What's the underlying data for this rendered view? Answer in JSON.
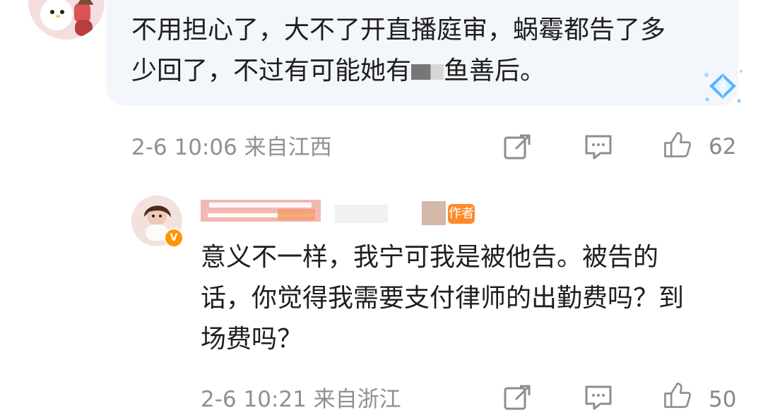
{
  "comment_1": {
    "text_line_1": "不用担心了，大不了开直播庭审，蜗霉都告了多",
    "text_line_2_before": "少回了，不过有可能她有",
    "text_line_2_after": "鱼善后。",
    "meta": "2-6 10:06 来自江西",
    "likes": "62"
  },
  "comment_2": {
    "author_tag": "作者",
    "text_line_1": "意义不一样，我宁可我是被他告。被告的",
    "text_line_2": "话，你觉得我需要支付律师的出勤费吗？到",
    "text_line_3": "场费吗？",
    "meta": "2-6 10:21 来自浙江",
    "likes": "50"
  },
  "icons": {
    "share": "share-icon",
    "comment": "comment-icon",
    "like": "like-icon",
    "verified": "verified-icon",
    "sticker": "diamond-sticker-icon"
  },
  "colors": {
    "bubble": "#f3f6fb",
    "meta_text": "#909090",
    "body_text": "#1e1e1e",
    "accent": "#ff9400"
  }
}
